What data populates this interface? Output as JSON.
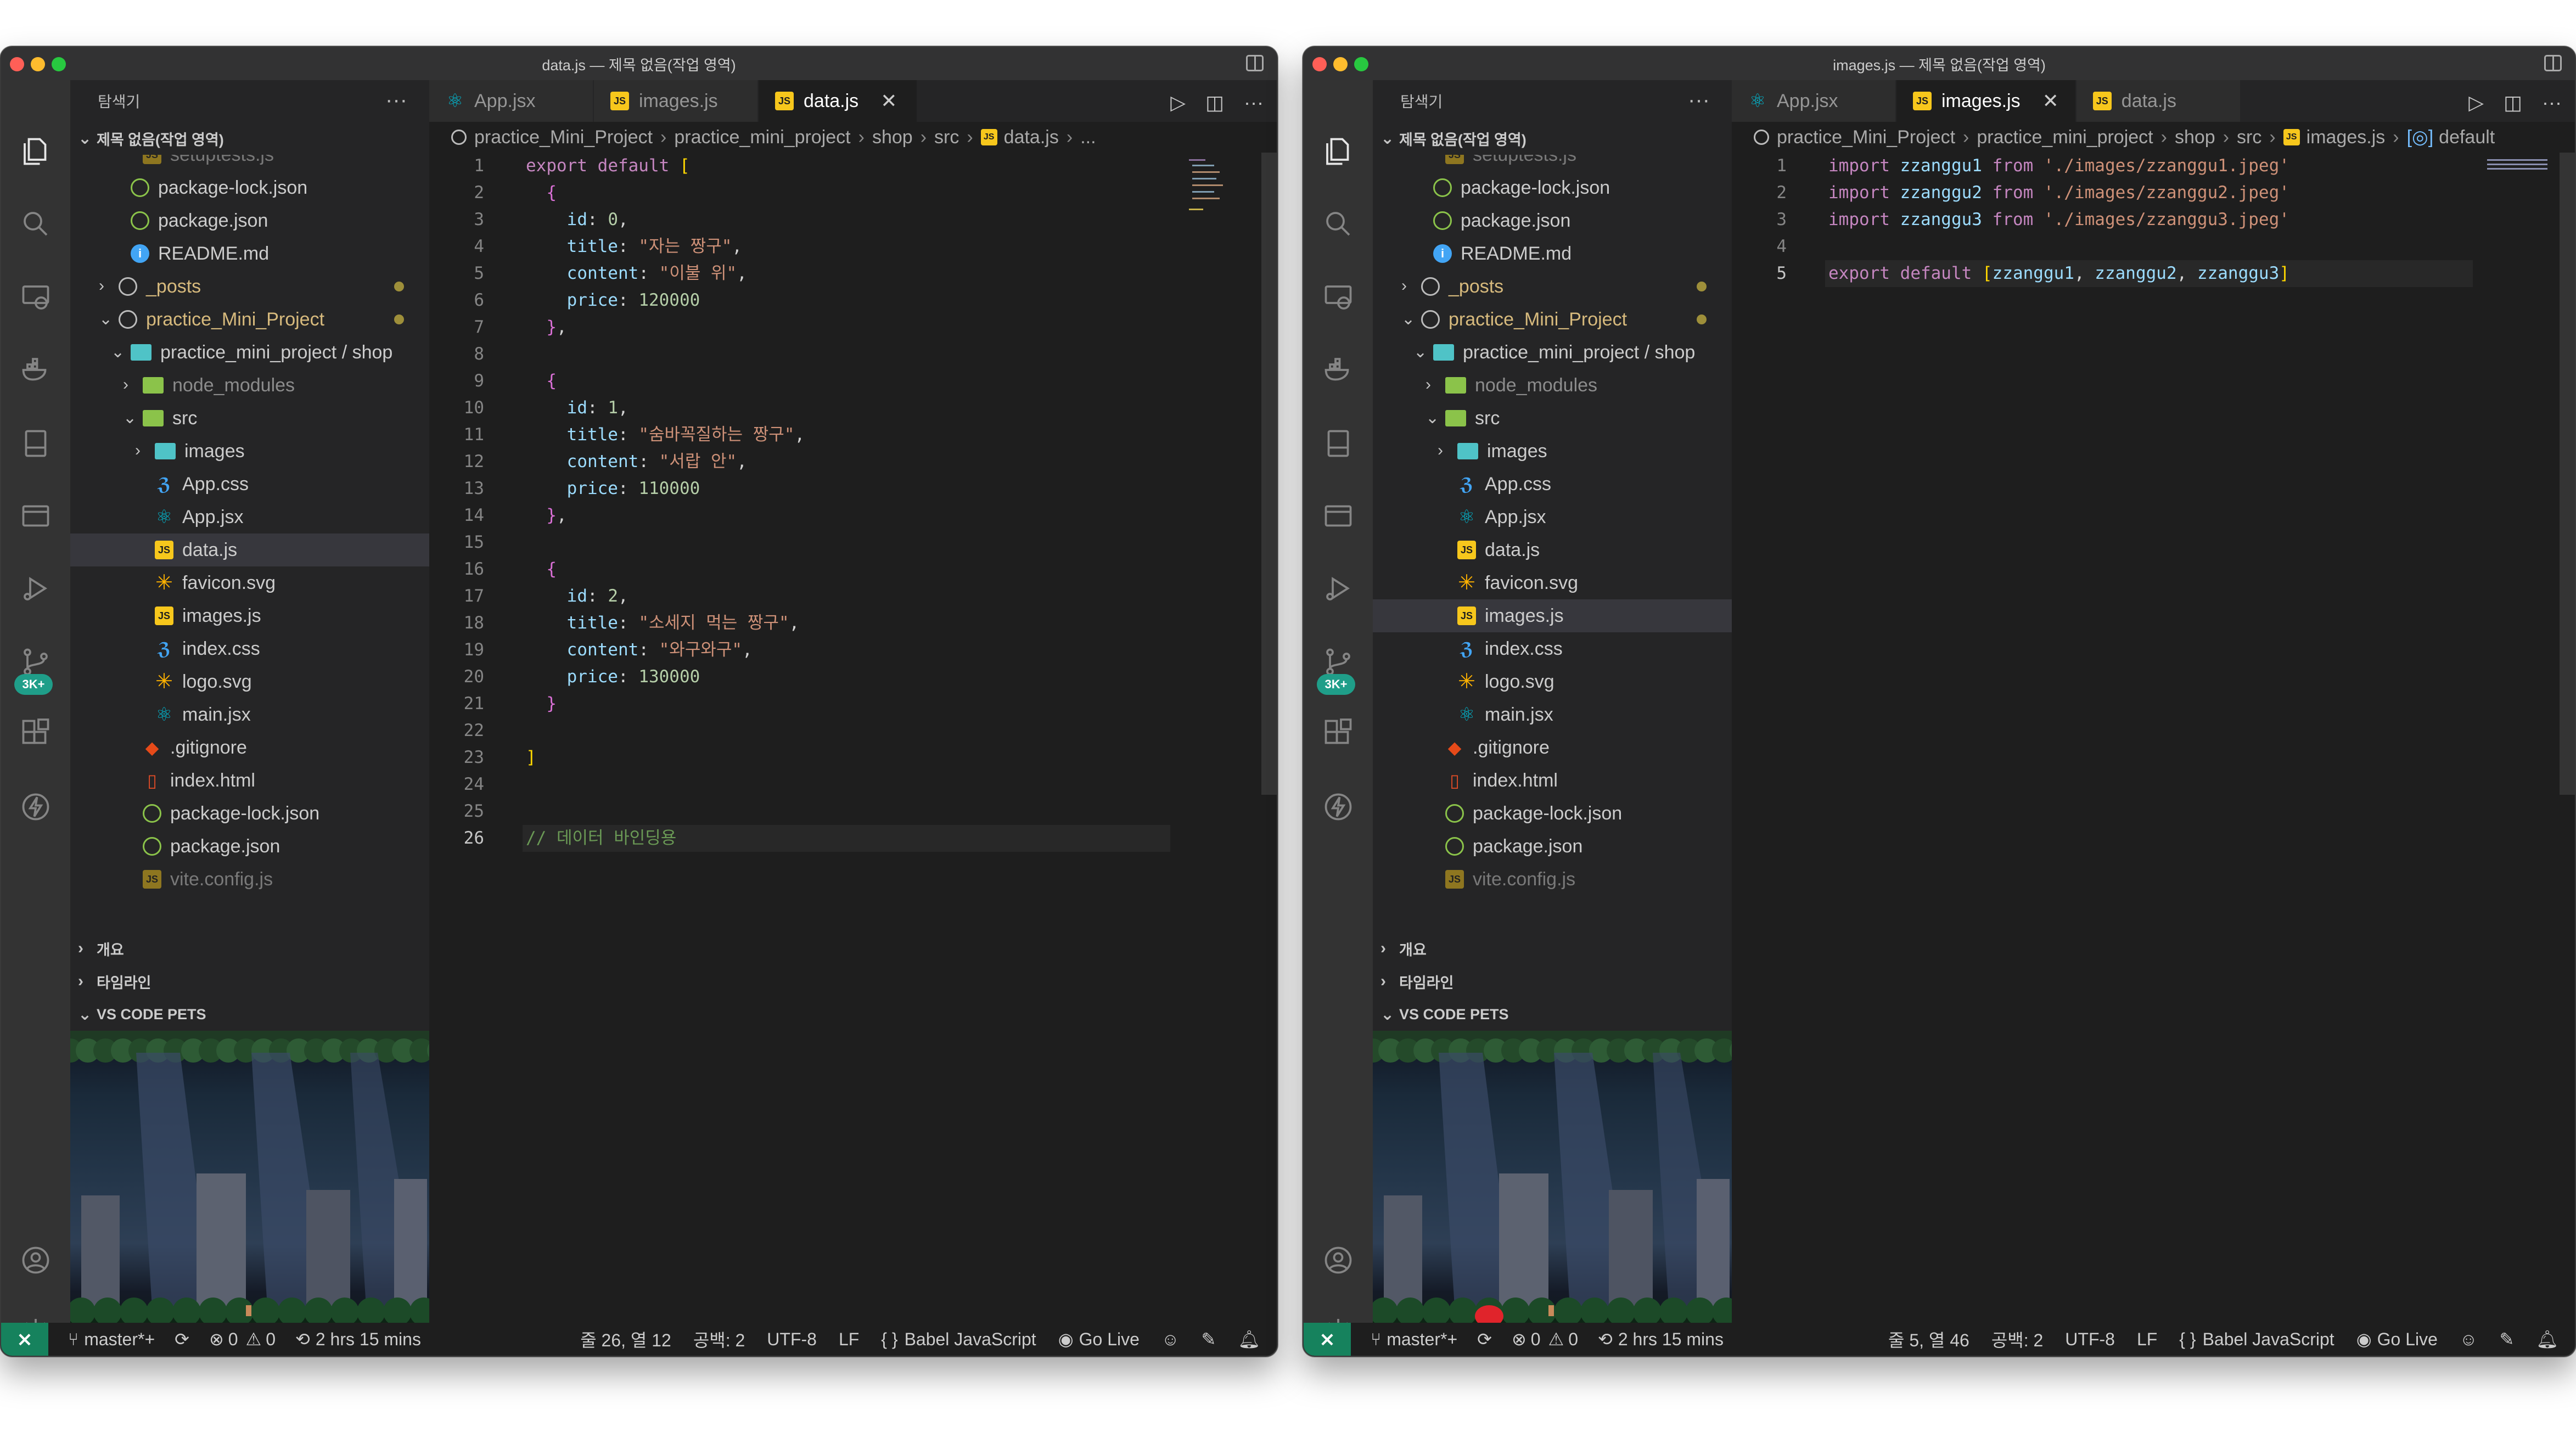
{
  "left": {
    "title": "data.js — 제목 없음(작업 영역)",
    "explorer_title": "탐색기",
    "workspace_name": "제목 없음(작업 영역)",
    "tabs": [
      {
        "label": "App.jsx",
        "icon": "react-icon"
      },
      {
        "label": "images.js",
        "icon": "js-file-icon"
      },
      {
        "label": "data.js",
        "icon": "js-file-icon",
        "active": true,
        "close": "✕"
      }
    ],
    "breadcrumb": [
      "practice_Mini_Project",
      "practice_mini_project",
      "shop",
      "src",
      "data.js",
      "..."
    ],
    "tree": [
      {
        "label": "setuptests.js",
        "icon": "js-file-icon",
        "indent": 2,
        "faded": true
      },
      {
        "label": "package-lock.json",
        "icon": "json-icon",
        "indent": 1
      },
      {
        "label": "package.json",
        "icon": "json-icon",
        "indent": 1
      },
      {
        "label": "README.md",
        "icon": "info-icon",
        "indent": 1
      },
      {
        "label": "_posts",
        "icon": "folder-icon",
        "indent": 0,
        "chevron": "›",
        "dot": true
      },
      {
        "label": "practice_Mini_Project",
        "icon": "folder-icon",
        "indent": 0,
        "chevron": "⌄",
        "dot": true
      },
      {
        "label": "practice_mini_project / shop",
        "icon": "folder-icon",
        "indent": 1,
        "chevron": "⌄"
      },
      {
        "label": "node_modules",
        "icon": "folder-icon",
        "indent": 2,
        "chevron": "›",
        "muted": true
      },
      {
        "label": "src",
        "icon": "folder-icon",
        "indent": 2,
        "chevron": "⌄"
      },
      {
        "label": "images",
        "icon": "folder-icon",
        "indent": 3,
        "chevron": "›"
      },
      {
        "label": "App.css",
        "icon": "css-icon",
        "indent": 3
      },
      {
        "label": "App.jsx",
        "icon": "react-icon",
        "indent": 3
      },
      {
        "label": "data.js",
        "icon": "js-file-icon",
        "indent": 3,
        "selected": true
      },
      {
        "label": "favicon.svg",
        "icon": "svg-icon",
        "indent": 3
      },
      {
        "label": "images.js",
        "icon": "js-file-icon",
        "indent": 3
      },
      {
        "label": "index.css",
        "icon": "css-icon",
        "indent": 3
      },
      {
        "label": "logo.svg",
        "icon": "svg-icon",
        "indent": 3
      },
      {
        "label": "main.jsx",
        "icon": "react-icon",
        "indent": 3
      },
      {
        "label": ".gitignore",
        "icon": "git-icon",
        "indent": 2
      },
      {
        "label": "index.html",
        "icon": "html-icon",
        "indent": 2
      },
      {
        "label": "package-lock.json",
        "icon": "json-icon",
        "indent": 2
      },
      {
        "label": "package.json",
        "icon": "json-icon",
        "indent": 2
      },
      {
        "label": "vite.config.js",
        "icon": "js-file-icon",
        "indent": 2,
        "faded": true
      }
    ],
    "sections": [
      "개요",
      "타임라인",
      "VS CODE PETS"
    ],
    "code": [
      [
        [
          "kw",
          "export"
        ],
        [
          "punc",
          " "
        ],
        [
          "kw",
          "default"
        ],
        [
          "punc",
          " "
        ],
        [
          "br1",
          "["
        ]
      ],
      [
        [
          "punc",
          "  "
        ],
        [
          "br2",
          "{"
        ]
      ],
      [
        [
          "punc",
          "    "
        ],
        [
          "prop",
          "id"
        ],
        [
          "punc",
          ": "
        ],
        [
          "num",
          "0"
        ],
        [
          "punc",
          ","
        ]
      ],
      [
        [
          "punc",
          "    "
        ],
        [
          "prop",
          "title"
        ],
        [
          "punc",
          ": "
        ],
        [
          "str",
          "\"자는 짱구\""
        ],
        [
          "punc",
          ","
        ]
      ],
      [
        [
          "punc",
          "    "
        ],
        [
          "prop",
          "content"
        ],
        [
          "punc",
          ": "
        ],
        [
          "str",
          "\"이불 위\""
        ],
        [
          "punc",
          ","
        ]
      ],
      [
        [
          "punc",
          "    "
        ],
        [
          "prop",
          "price"
        ],
        [
          "punc",
          ": "
        ],
        [
          "num",
          "120000"
        ]
      ],
      [
        [
          "punc",
          "  "
        ],
        [
          "br2",
          "}"
        ],
        [
          "punc",
          ","
        ]
      ],
      [],
      [
        [
          "punc",
          "  "
        ],
        [
          "br2",
          "{"
        ]
      ],
      [
        [
          "punc",
          "    "
        ],
        [
          "prop",
          "id"
        ],
        [
          "punc",
          ": "
        ],
        [
          "num",
          "1"
        ],
        [
          "punc",
          ","
        ]
      ],
      [
        [
          "punc",
          "    "
        ],
        [
          "prop",
          "title"
        ],
        [
          "punc",
          ": "
        ],
        [
          "str",
          "\"숨바꼭질하는 짱구\""
        ],
        [
          "punc",
          ","
        ]
      ],
      [
        [
          "punc",
          "    "
        ],
        [
          "prop",
          "content"
        ],
        [
          "punc",
          ": "
        ],
        [
          "str",
          "\"서랍 안\""
        ],
        [
          "punc",
          ","
        ]
      ],
      [
        [
          "punc",
          "    "
        ],
        [
          "prop",
          "price"
        ],
        [
          "punc",
          ": "
        ],
        [
          "num",
          "110000"
        ]
      ],
      [
        [
          "punc",
          "  "
        ],
        [
          "br2",
          "}"
        ],
        [
          "punc",
          ","
        ]
      ],
      [],
      [
        [
          "punc",
          "  "
        ],
        [
          "br2",
          "{"
        ]
      ],
      [
        [
          "punc",
          "    "
        ],
        [
          "prop",
          "id"
        ],
        [
          "punc",
          ": "
        ],
        [
          "num",
          "2"
        ],
        [
          "punc",
          ","
        ]
      ],
      [
        [
          "punc",
          "    "
        ],
        [
          "prop",
          "title"
        ],
        [
          "punc",
          ": "
        ],
        [
          "str",
          "\"소세지 먹는 짱구\""
        ],
        [
          "punc",
          ","
        ]
      ],
      [
        [
          "punc",
          "    "
        ],
        [
          "prop",
          "content"
        ],
        [
          "punc",
          ": "
        ],
        [
          "str",
          "\"와구와구\""
        ],
        [
          "punc",
          ","
        ]
      ],
      [
        [
          "punc",
          "    "
        ],
        [
          "prop",
          "price"
        ],
        [
          "punc",
          ": "
        ],
        [
          "num",
          "130000"
        ]
      ],
      [
        [
          "punc",
          "  "
        ],
        [
          "br2",
          "}"
        ]
      ],
      [],
      [
        [
          "br1",
          "]"
        ]
      ],
      [],
      [],
      [
        [
          "com",
          "// 데이터 바인딩용"
        ]
      ]
    ],
    "current_line": 26,
    "status": {
      "branch": "master*+",
      "errors": "0",
      "warnings": "0",
      "time": "2 hrs 15 mins",
      "cursor": "줄 26, 열 12",
      "spaces": "공백: 2",
      "encoding": "UTF-8",
      "eol": "LF",
      "language": "Babel JavaScript",
      "golive": "Go Live"
    }
  },
  "right": {
    "title": "images.js — 제목 없음(작업 영역)",
    "explorer_title": "탐색기",
    "workspace_name": "제목 없음(작업 영역)",
    "tabs": [
      {
        "label": "App.jsx",
        "icon": "react-icon"
      },
      {
        "label": "images.js",
        "icon": "js-file-icon",
        "active": true,
        "close": "✕"
      },
      {
        "label": "data.js",
        "icon": "js-file-icon"
      }
    ],
    "breadcrumb": [
      "practice_Mini_Project",
      "practice_mini_project",
      "shop",
      "src",
      "images.js",
      "default"
    ],
    "tree": [
      {
        "label": "setuptests.js",
        "icon": "js-file-icon",
        "indent": 2,
        "faded": true
      },
      {
        "label": "package-lock.json",
        "icon": "json-icon",
        "indent": 1
      },
      {
        "label": "package.json",
        "icon": "json-icon",
        "indent": 1
      },
      {
        "label": "README.md",
        "icon": "info-icon",
        "indent": 1
      },
      {
        "label": "_posts",
        "icon": "folder-icon",
        "indent": 0,
        "chevron": "›",
        "dot": true
      },
      {
        "label": "practice_Mini_Project",
        "icon": "folder-icon",
        "indent": 0,
        "chevron": "⌄",
        "dot": true
      },
      {
        "label": "practice_mini_project / shop",
        "icon": "folder-icon",
        "indent": 1,
        "chevron": "⌄"
      },
      {
        "label": "node_modules",
        "icon": "folder-icon",
        "indent": 2,
        "chevron": "›",
        "muted": true
      },
      {
        "label": "src",
        "icon": "folder-icon",
        "indent": 2,
        "chevron": "⌄"
      },
      {
        "label": "images",
        "icon": "folder-icon",
        "indent": 3,
        "chevron": "›"
      },
      {
        "label": "App.css",
        "icon": "css-icon",
        "indent": 3
      },
      {
        "label": "App.jsx",
        "icon": "react-icon",
        "indent": 3
      },
      {
        "label": "data.js",
        "icon": "js-file-icon",
        "indent": 3
      },
      {
        "label": "favicon.svg",
        "icon": "svg-icon",
        "indent": 3
      },
      {
        "label": "images.js",
        "icon": "js-file-icon",
        "indent": 3,
        "selected": true
      },
      {
        "label": "index.css",
        "icon": "css-icon",
        "indent": 3
      },
      {
        "label": "logo.svg",
        "icon": "svg-icon",
        "indent": 3
      },
      {
        "label": "main.jsx",
        "icon": "react-icon",
        "indent": 3
      },
      {
        "label": ".gitignore",
        "icon": "git-icon",
        "indent": 2
      },
      {
        "label": "index.html",
        "icon": "html-icon",
        "indent": 2
      },
      {
        "label": "package-lock.json",
        "icon": "json-icon",
        "indent": 2
      },
      {
        "label": "package.json",
        "icon": "json-icon",
        "indent": 2
      },
      {
        "label": "vite.config.js",
        "icon": "js-file-icon",
        "indent": 2,
        "faded": true
      }
    ],
    "sections": [
      "개요",
      "타임라인",
      "VS CODE PETS"
    ],
    "code": [
      [
        [
          "kw",
          "import"
        ],
        [
          "punc",
          " "
        ],
        [
          "var",
          "zzanggu1"
        ],
        [
          "punc",
          " "
        ],
        [
          "kw",
          "from"
        ],
        [
          "punc",
          " "
        ],
        [
          "str",
          "'./images/zzanggu1.jpeg'"
        ]
      ],
      [
        [
          "kw",
          "import"
        ],
        [
          "punc",
          " "
        ],
        [
          "var",
          "zzanggu2"
        ],
        [
          "punc",
          " "
        ],
        [
          "kw",
          "from"
        ],
        [
          "punc",
          " "
        ],
        [
          "str",
          "'./images/zzanggu2.jpeg'"
        ]
      ],
      [
        [
          "kw",
          "import"
        ],
        [
          "punc",
          " "
        ],
        [
          "var",
          "zzanggu3"
        ],
        [
          "punc",
          " "
        ],
        [
          "kw",
          "from"
        ],
        [
          "punc",
          " "
        ],
        [
          "str",
          "'./images/zzanggu3.jpeg'"
        ]
      ],
      [],
      [
        [
          "kw",
          "export"
        ],
        [
          "punc",
          " "
        ],
        [
          "kw",
          "default"
        ],
        [
          "punc",
          " "
        ],
        [
          "br1",
          "["
        ],
        [
          "var",
          "zzanggu1"
        ],
        [
          "punc",
          ", "
        ],
        [
          "var",
          "zzanggu2"
        ],
        [
          "punc",
          ", "
        ],
        [
          "var",
          "zzanggu3"
        ],
        [
          "br1",
          "]"
        ]
      ]
    ],
    "current_line": 5,
    "status": {
      "branch": "master*+",
      "errors": "0",
      "warnings": "0",
      "time": "2 hrs 15 mins",
      "cursor": "줄 5, 열 46",
      "spaces": "공백: 2",
      "encoding": "UTF-8",
      "eol": "LF",
      "language": "Babel JavaScript",
      "golive": "Go Live"
    }
  },
  "activity_badge": "3K+",
  "colors": {
    "accent_green": "#16825d",
    "badge": "#1f9e89",
    "keyword": "#c586c0",
    "string": "#ce9178",
    "number": "#b5cea8",
    "comment": "#6a9955"
  }
}
